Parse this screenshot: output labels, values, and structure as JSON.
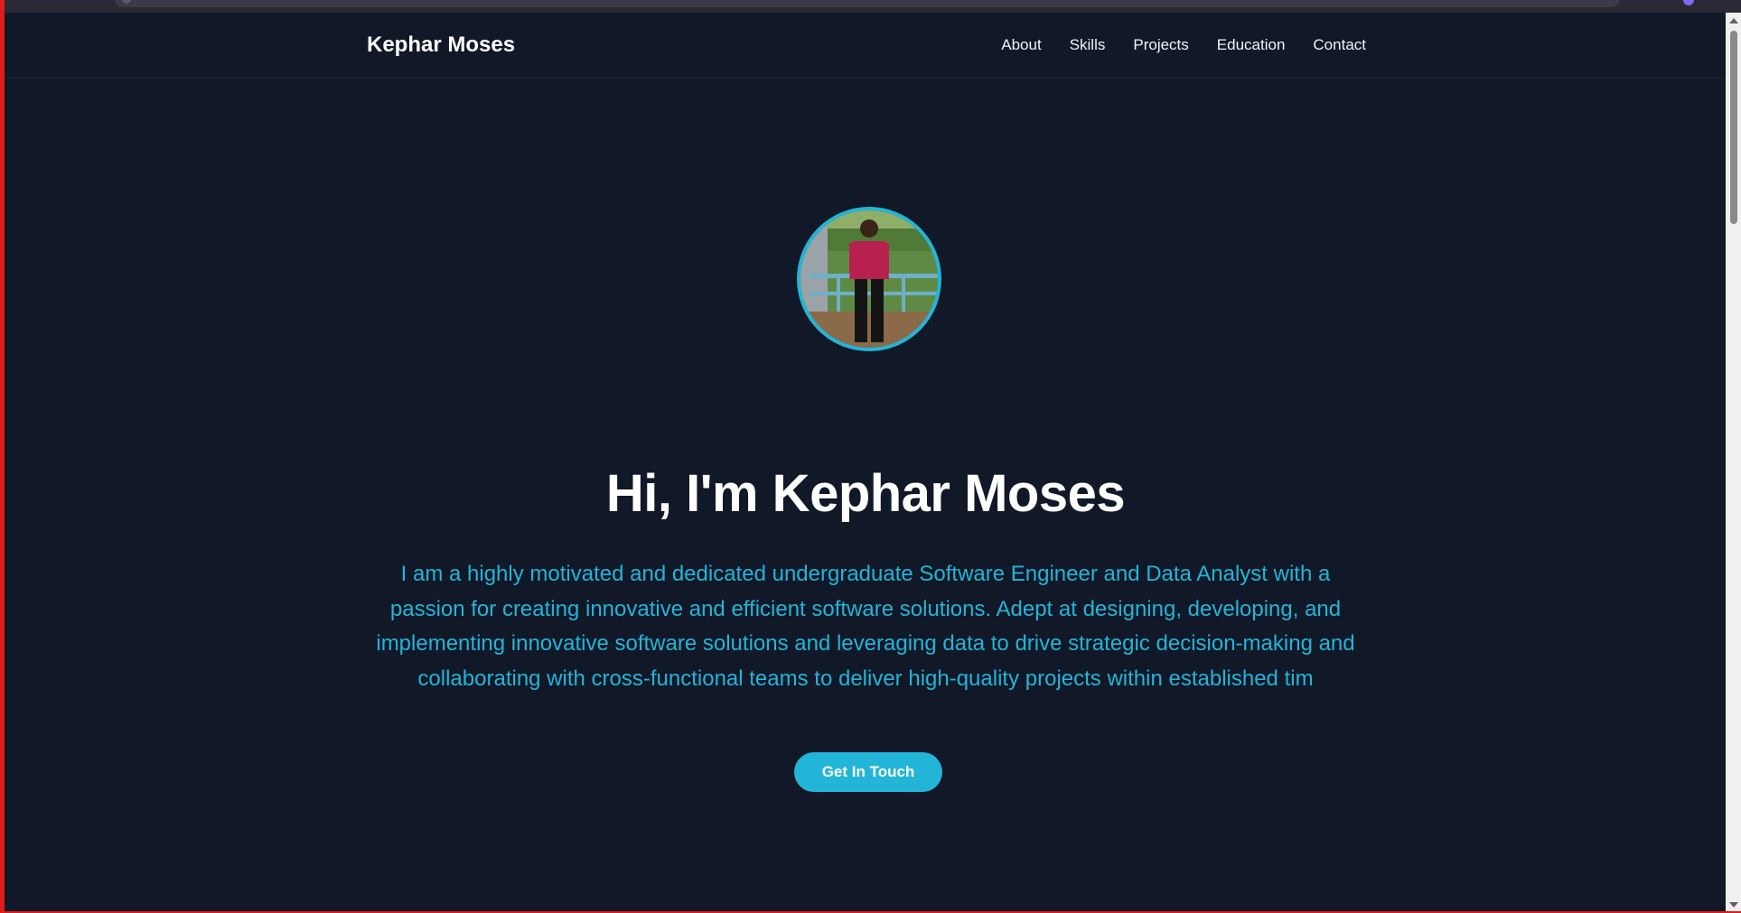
{
  "nav": {
    "brand": "Kephar Moses",
    "links": [
      "About",
      "Skills",
      "Projects",
      "Education",
      "Contact"
    ]
  },
  "hero": {
    "title": "Hi, I'm Kephar Moses",
    "description": "I am a highly motivated and dedicated undergraduate Software Engineer and Data Analyst with a passion for creating innovative and efficient software solutions. Adept at designing, developing, and implementing innovative software solutions and leveraging data to drive strategic decision-making and collaborating with cross-functional teams to deliver high-quality projects within established tim",
    "cta_label": "Get In Touch"
  },
  "colors": {
    "background": "#111827",
    "accent": "#22b5d8",
    "text": "#ffffff"
  }
}
